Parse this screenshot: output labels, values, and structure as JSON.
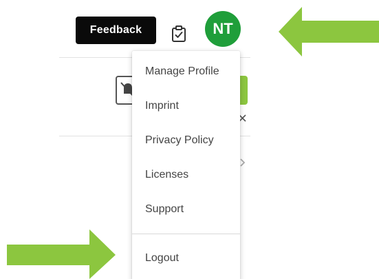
{
  "header": {
    "feedback_label": "Feedback",
    "avatar_initials": "NT"
  },
  "user_menu": {
    "items": [
      {
        "label": "Manage Profile"
      },
      {
        "label": "Imprint"
      },
      {
        "label": "Privacy Policy"
      },
      {
        "label": "Licenses"
      },
      {
        "label": "Support"
      }
    ],
    "logout_label": "Logout"
  },
  "icons": {
    "tasks": "clipboard-check-icon",
    "mute": "bell-off-icon",
    "close": "close-icon",
    "chevron": "chevron-right-icon"
  },
  "colors": {
    "avatar_bg": "#1f9e3a",
    "feedback_bg": "#0a0a0a",
    "annotation_arrow": "#8cc63f",
    "menu_text": "#444444"
  }
}
